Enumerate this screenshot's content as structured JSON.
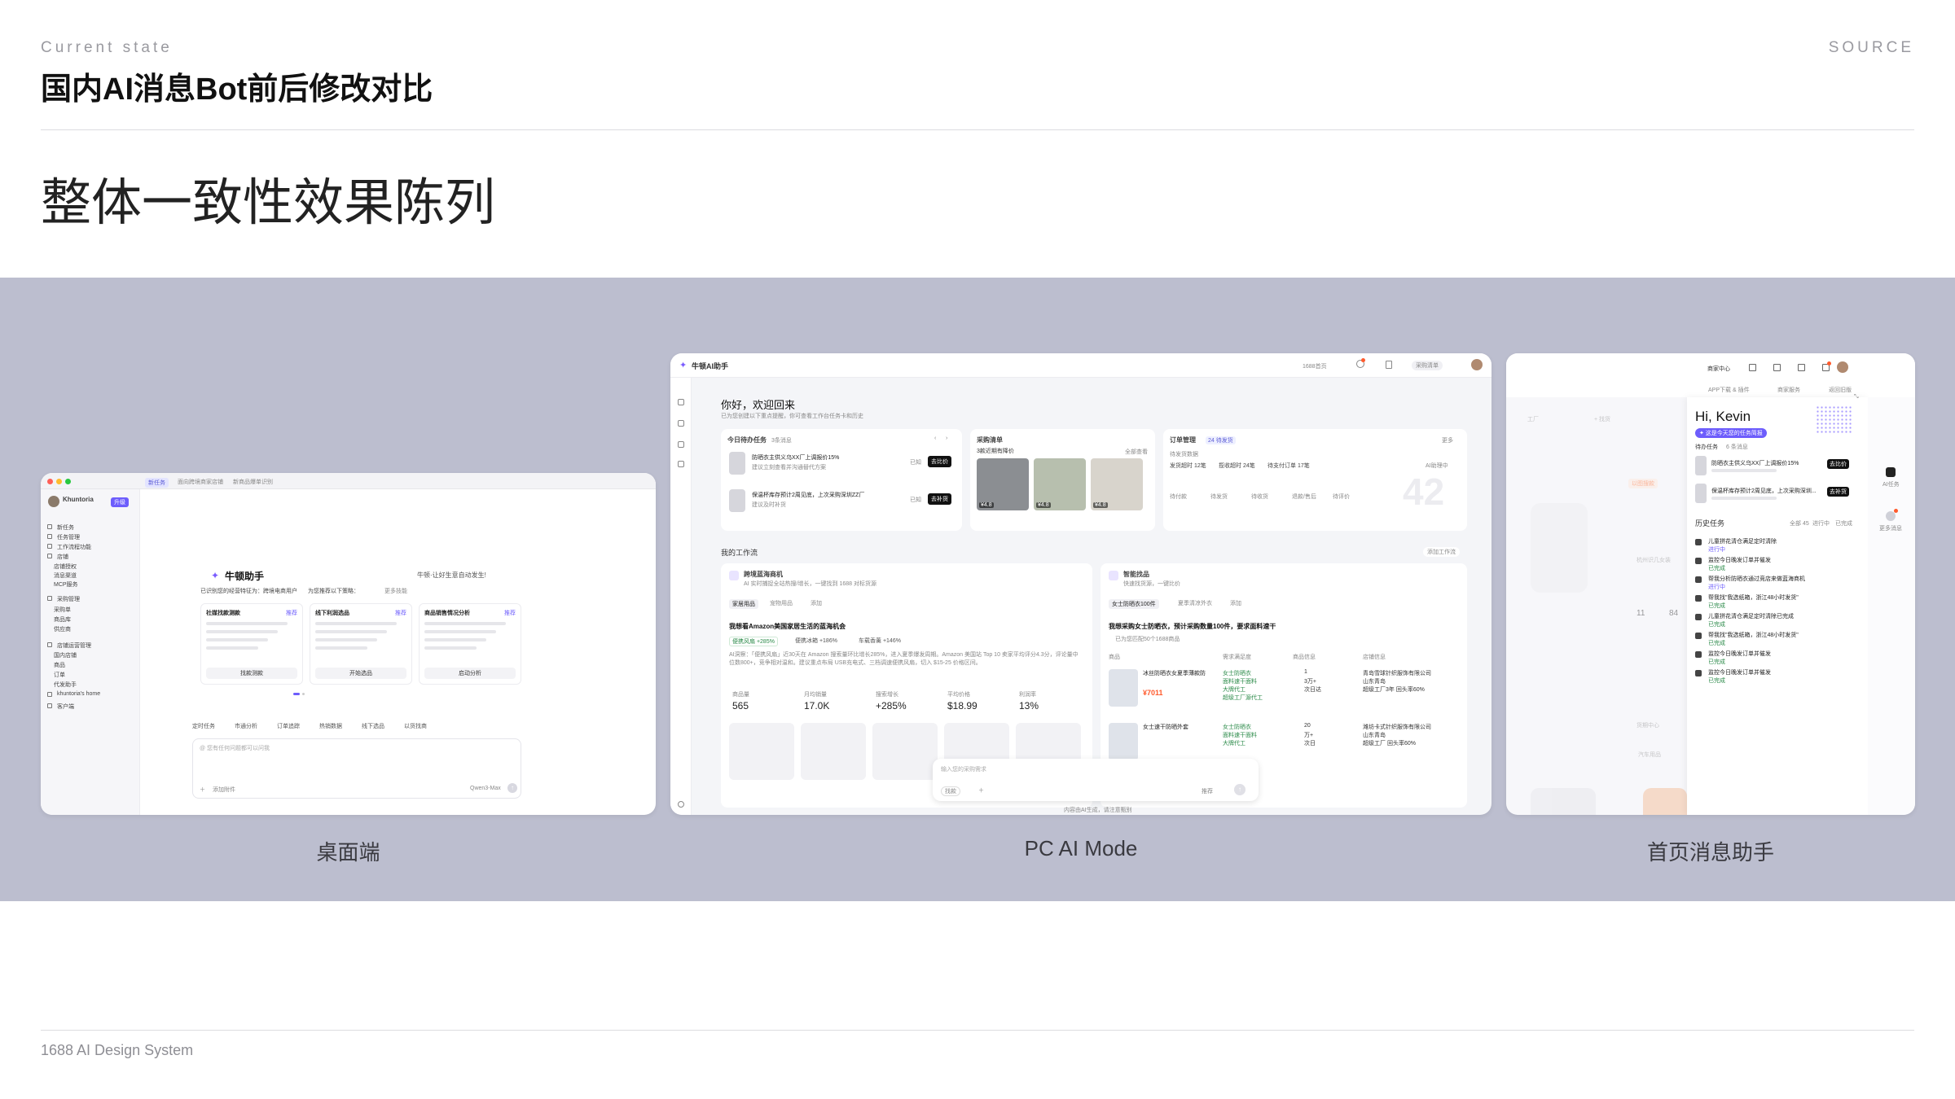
{
  "header": {
    "eyebrow": "Current state",
    "title": "国内AI消息Bot前后修改对比",
    "source": "SOURCE",
    "subtitle": "整体一致性效果陈列"
  },
  "footer": {
    "text": "1688 AI Design System"
  },
  "showcase": [
    {
      "caption": "桌面端"
    },
    {
      "caption": "PC AI Mode"
    },
    {
      "caption": "首页消息助手"
    }
  ],
  "desktop": {
    "tabs": [
      "新任务",
      "面向跨境商家店铺",
      "新商品爆单识别"
    ],
    "user": "Khuntoria",
    "badge": "升级",
    "nav": [
      "新任务",
      "任务管理",
      "工作流程功能",
      "店铺",
      "店铺授权",
      "消息渠道",
      "MCP服务",
      "采购管理",
      "采购单",
      "商品库",
      "供应商",
      "店铺运营管理",
      "国内店铺",
      "商品",
      "订单",
      "代发助手",
      "khuntoria's home",
      "客户端"
    ],
    "brand": "牛顿助手",
    "slogan": "牛顿·让好生意自动发生!",
    "identity": "已识别您的经营特征为：跨境电商用户",
    "identity_suffix": "为您推荐以下策略：",
    "more_skills": "更多技能",
    "cards": [
      {
        "title": "社媒找款测款",
        "tag": "推荐",
        "action": "找款测款"
      },
      {
        "title": "线下利润选品",
        "tag": "推荐",
        "action": "开始选品"
      },
      {
        "title": "商品销售情况分析",
        "tag": "推荐",
        "action": "启动分析"
      }
    ],
    "chips": [
      "定时任务",
      "市通分析",
      "订单追踪",
      "热销数据",
      "线下选品",
      "以货找商"
    ],
    "input_placeholder": "@ 您有任何问题都可以问我",
    "attach": "添加附件",
    "model": "Qwen3-Max"
  },
  "pc": {
    "brand": "牛顿AI助手",
    "header_links": [
      "1688首页",
      "采购清单"
    ],
    "greeting": "你好，欢迎回来",
    "greeting_sub": "已为您创建以下重点提醒，你可查看工作台任务卡和历史",
    "todo": {
      "title": "今日待办任务",
      "count": "3条消息",
      "items": [
        {
          "text": "防晒衣主供义乌XX厂上调报价15%",
          "sub": "建议立刻查看并沟通替代方案",
          "action": "去比价",
          "tag": "已知"
        },
        {
          "text": "保温杯库存预计2周见底，上次采购深圳ZZ厂",
          "sub": "建议及时补货",
          "action": "去补货",
          "tag": "已知"
        }
      ]
    },
    "purchase": {
      "title": "采购清单",
      "sub": "3款近期有降价",
      "more": "全部查看",
      "prices": [
        "¥4.8",
        "¥4.8",
        "¥4.8"
      ]
    },
    "orders": {
      "title": "订单管理",
      "badge": "24 待发货",
      "more": "更多",
      "sub": "待发货数据",
      "stats": [
        "发货超时 12笔",
        "揽收超时 24笔",
        "待支付订单 17笔"
      ],
      "labels": [
        "待付款",
        "待发货",
        "待收货",
        "退款/售后",
        "待评价"
      ],
      "big": "42",
      "ai_label": "AI助理中"
    },
    "workflow_title": "我的工作流",
    "add_flow": "添加工作流",
    "flow_left": {
      "title": "跨境蓝海商机",
      "sub": "AI 实时捕捉全站热搜/增长，一键找到 1688 对标货源",
      "tabs": [
        "家居用品",
        "宠物用品",
        "添加"
      ],
      "headline": "我想看Amazon美国家居生活的蓝海机会",
      "pills": [
        "便携风扇 +285%",
        "便携冰箱 +186%",
        "车载香薰 +146%"
      ],
      "body": "AI洞察：「便携风扇」近30天在 Amazon 搜索量环比增长285%，进入夏季爆发周期。Amazon 美国站 Top 10 卖家平均评分4.3分，评论量中位数800+，竞争相对温和。建议重点布局 USB充电式、三档调速便携风扇，切入 $15-25 价格区间。",
      "stats": [
        {
          "label": "商品量",
          "value": "565"
        },
        {
          "label": "月均销量",
          "value": "17.0K"
        },
        {
          "label": "搜索增长",
          "value": "+285%"
        },
        {
          "label": "平均价格",
          "value": "$18.99"
        },
        {
          "label": "利润率",
          "value": "13%"
        }
      ]
    },
    "flow_right": {
      "title": "智能找品",
      "sub": "快速找货源，一键比价",
      "tabs": [
        "女士防晒衣100件",
        "夏季清凉外衣",
        "添加"
      ],
      "headline": "我想采购女士防晒衣，预计采购数量100件，要求面料速干",
      "sub2": "已为您匹配50个1688商品",
      "cols": [
        "商品",
        "需求满足度",
        "商品信息",
        "店铺信息"
      ],
      "rows": [
        {
          "name": "冰丝防晒衣女夏季薄款防",
          "price": "¥7011",
          "meet": [
            "女士防晒衣",
            "面料速干面料",
            "大牌代工",
            "超级工厂源代工"
          ],
          "info": [
            "1",
            "3万+",
            "次日达"
          ],
          "shop": [
            "青岛雪球针织服饰有限公司",
            "山东青岛",
            "超级工厂3年 回头率60%"
          ]
        },
        {
          "name": "女士速干防晒外套",
          "price": "",
          "meet": [
            "女士防晒衣",
            "面料速干面料",
            "大牌代工"
          ],
          "info": [
            "20",
            "万+",
            "次日"
          ],
          "shop": [
            "潍坊卡式针织服饰有限公司",
            "山东青岛",
            "超级工厂 回头率60%"
          ]
        }
      ]
    },
    "input_placeholder": "输入您的采购需求",
    "input_chip": "找款",
    "input_right": "推荐",
    "disclaimer": "内容由AI生成，请注意甄别"
  },
  "home": {
    "header": {
      "items": [
        "商家中心"
      ],
      "menus": [
        "APP下载 & 插件",
        "商家服务",
        "返回旧版"
      ]
    },
    "greeting": "Hi, Kevin",
    "tag": "✦ 这是今天您的任务简报",
    "todo_label": "待办任务",
    "todo_count": "6 条消息",
    "todos": [
      {
        "text": "防晒衣主供义乌XX厂上调报价15%",
        "action": "去比价"
      },
      {
        "text": "保温杯库存预计2周见底，上次采购深圳...",
        "action": "去补货"
      }
    ],
    "history_label": "历史任务",
    "history_filter": [
      "全部 45",
      "进行中",
      "已完成"
    ],
    "history": [
      {
        "text": "儿童拼花清仓满足定时清除",
        "status": "进行中"
      },
      {
        "text": "监控今日晚发订单并催发",
        "status": "已完成"
      },
      {
        "text": "帮我分析防晒衣通过竞店来做蓝海商机",
        "status": "进行中"
      },
      {
        "text": "帮我找\"我选纸箱，浙江48小时发货\"",
        "status": "已完成"
      },
      {
        "text": "儿童拼花清仓满足定时清除已完成",
        "status": "已完成"
      },
      {
        "text": "帮我找\"我选纸箱，浙江48小时发货\"",
        "status": "已完成"
      },
      {
        "text": "监控今日晚发订单并催发",
        "status": "已完成"
      },
      {
        "text": "监控今日晚发订单并催发",
        "status": "已完成"
      }
    ],
    "side_labels": [
      "AI任务",
      "更多消息"
    ],
    "bg_labels": [
      "工厂",
      "+ 找货",
      "以图搜款",
      "杭州识几女装",
      "货期中心",
      "汽车用品"
    ],
    "bg_stats": [
      "11",
      "84"
    ]
  }
}
